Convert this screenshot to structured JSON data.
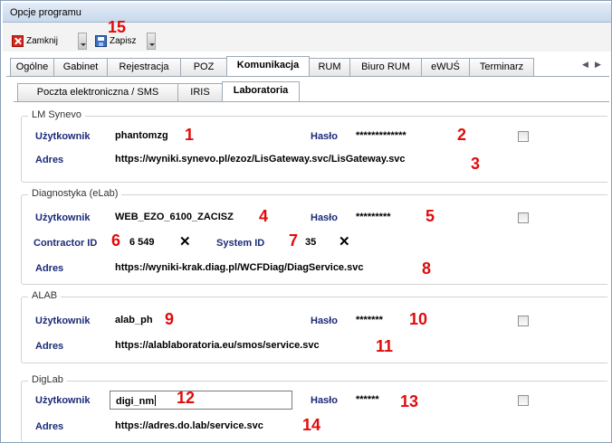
{
  "window": {
    "title": "Opcje programu"
  },
  "toolbar": {
    "close_label": "Zamknij",
    "save_label": "Zapisz"
  },
  "main_tabs": [
    {
      "label": "Ogólne"
    },
    {
      "label": "Gabinet"
    },
    {
      "label": "Rejestracja"
    },
    {
      "label": "POZ"
    },
    {
      "label": "Komunikacja"
    },
    {
      "label": "RUM"
    },
    {
      "label": "Biuro RUM"
    },
    {
      "label": "eWUŚ"
    },
    {
      "label": "Terminarz"
    }
  ],
  "sub_tabs": [
    {
      "label": "Poczta elektroniczna / SMS"
    },
    {
      "label": "IRIS"
    },
    {
      "label": "Laboratoria"
    }
  ],
  "labels": {
    "user": "Użytkownik",
    "password": "Hasło",
    "address": "Adres",
    "contractor_id": "Contractor ID",
    "system_id": "System ID"
  },
  "groups": [
    {
      "title": "LM Synevo",
      "user": "phantomzg",
      "password": "*************",
      "address": "https://wyniki.synevo.pl/ezoz/LisGateway.svc/LisGateway.svc"
    },
    {
      "title": "Diagnostyka (eLab)",
      "user": "WEB_EZO_6100_ZACISZ",
      "password": "*********",
      "contractor_id": "6 549",
      "system_id": "35",
      "address": "https://wyniki-krak.diag.pl/WCFDiag/DiagService.svc"
    },
    {
      "title": "ALAB",
      "user": "alab_ph",
      "password": "*******",
      "address": "https://alablaboratoria.eu/smos/service.svc"
    },
    {
      "title": "DigLab",
      "user": "digi_nm",
      "password": "******",
      "address": "https://adres.do.lab/service.svc"
    }
  ],
  "annotations": [
    "1",
    "2",
    "3",
    "4",
    "5",
    "6",
    "7",
    "8",
    "9",
    "10",
    "11",
    "12",
    "13",
    "14",
    "15"
  ],
  "colors": {
    "annotation": "#e10b0b",
    "label": "#1b2a78"
  }
}
